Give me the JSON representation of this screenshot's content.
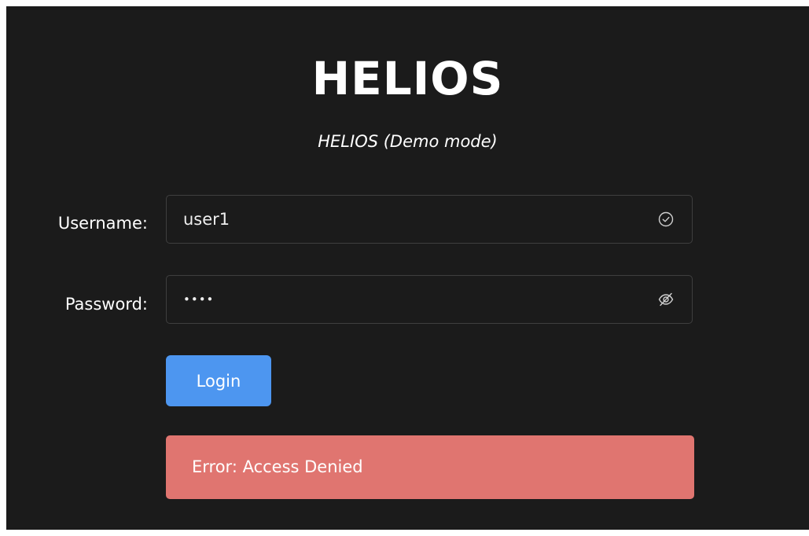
{
  "app": {
    "title": "HELIOS",
    "subtitle": "HELIOS (Demo mode)"
  },
  "form": {
    "username_label": "Username:",
    "username_value": "user1",
    "username_status_icon": "check-circle-icon",
    "password_label": "Password:",
    "password_value": "••••",
    "password_toggle_icon": "eye-off-icon",
    "login_label": "Login"
  },
  "error": {
    "message": "Error: Access Denied"
  },
  "colors": {
    "background": "#1b1b1b",
    "accent": "#4d96f0",
    "error": "#e07570",
    "field_border": "#3f3f3f"
  }
}
